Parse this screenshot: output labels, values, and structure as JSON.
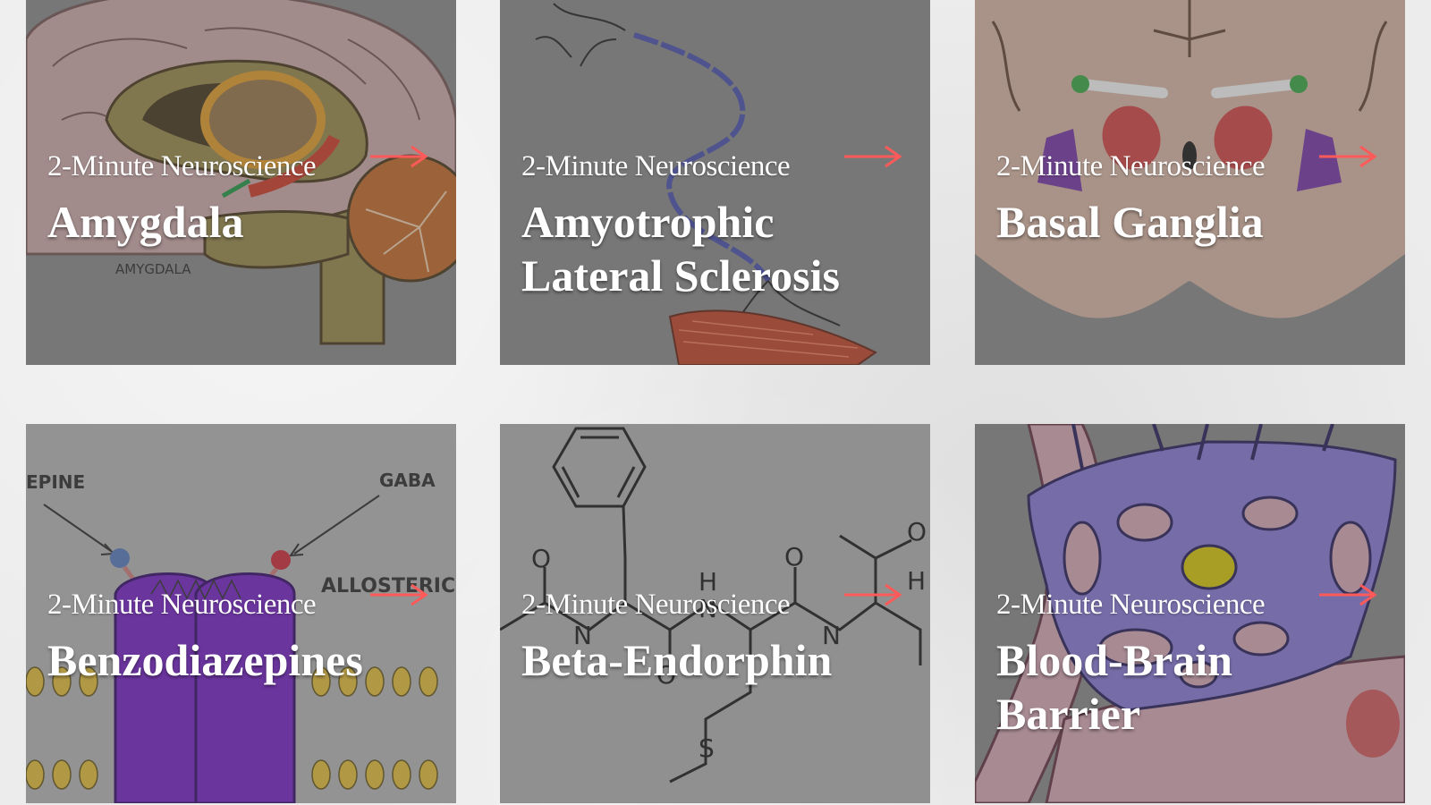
{
  "cards": [
    {
      "eyebrow": "2-Minute Neuroscience",
      "title": "Amygdala",
      "art_label": "AMYGDALA",
      "icon": "arrow-right-icon"
    },
    {
      "eyebrow": "2-Minute Neuroscience",
      "title": "Amyotrophic Lateral Sclerosis",
      "icon": "arrow-right-icon"
    },
    {
      "eyebrow": "2-Minute Neuroscience",
      "title": "Basal Ganglia",
      "icon": "arrow-right-icon"
    },
    {
      "eyebrow": "2-Minute Neuroscience",
      "title": "Benzodiazepines",
      "art_labels": [
        "EPINE",
        "GABA",
        "ALLOSTERIC"
      ],
      "icon": "arrow-right-icon"
    },
    {
      "eyebrow": "2-Minute Neuroscience",
      "title": "Beta-Endorphin",
      "art_labels": [
        "O",
        "O",
        "H",
        "N",
        "N",
        "N",
        "O",
        "O",
        "H",
        "S"
      ],
      "icon": "arrow-right-icon"
    },
    {
      "eyebrow": "2-Minute Neuroscience",
      "title": "Blood-Brain Barrier",
      "icon": "arrow-right-icon"
    }
  ],
  "colors": {
    "arrow": "#ff5a5a",
    "card_overlay": "#7d7d7d",
    "page_bg": "#ececec",
    "text": "#ffffff"
  }
}
